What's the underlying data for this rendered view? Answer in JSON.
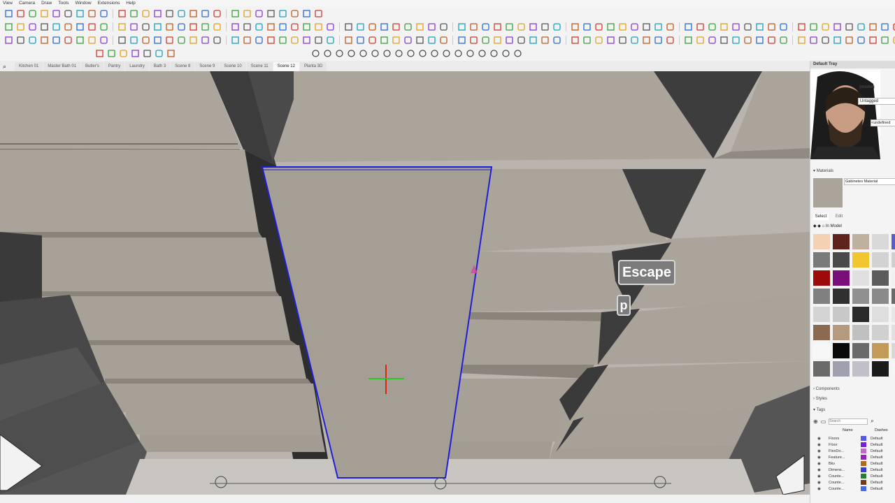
{
  "menu": [
    "View",
    "Camera",
    "Draw",
    "Tools",
    "Window",
    "Extensions",
    "Help"
  ],
  "scenes": {
    "tabs": [
      "Kitchen 01",
      "Master Bath 01",
      "Butler's",
      "Pantry",
      "Laundry",
      "Bath 3",
      "Scene 8",
      "Scene 9",
      "Scene 10",
      "Scene 11",
      "Scene 12",
      "Planta 3D"
    ],
    "active_index": 10
  },
  "tray": {
    "title": "Default Tray",
    "entity_model": "(model)",
    "tag_value": "Untagged",
    "undefined_value": "<undefined",
    "materials_header": "Materials",
    "current_material": "Gabinetes Material",
    "select_tab": "Select",
    "edit_tab": "Edit",
    "in_model": "In Model",
    "components_header": "Components",
    "styles_header": "Styles",
    "tags_header": "Tags",
    "search_placeholder": "Search",
    "col_name": "Name",
    "col_dashes": "Dashes",
    "tags": [
      {
        "name": "Floors",
        "color": "#5a5ad8",
        "dash": "Default"
      },
      {
        "name": "Floor",
        "color": "#7a1fd6",
        "dash": "Default"
      },
      {
        "name": "FlexDo...",
        "color": "#c06ac6",
        "dash": "Default"
      },
      {
        "name": "Feature...",
        "color": "#a01eb8",
        "dash": "Default"
      },
      {
        "name": "Bkv",
        "color": "#b06820",
        "dash": "Default"
      },
      {
        "name": "Dimens...",
        "color": "#3a3ad6",
        "dash": "Default"
      },
      {
        "name": "Counte...",
        "color": "#2a7a3a",
        "dash": "Default"
      },
      {
        "name": "Counte...",
        "color": "#7a3a10",
        "dash": "Default"
      },
      {
        "name": "Counte...",
        "color": "#4a6ad8",
        "dash": "Default"
      }
    ],
    "material_swatches": [
      "#f5d1b3",
      "#5e241c",
      "#bfb0a0",
      "#d9d9d9",
      "#5a5fc8",
      "#7a7a7a",
      "#4a4a4a",
      "#f2c630",
      "#d2d2d2",
      "#cfcfcf",
      "#9d0a0a",
      "#7a0f7a",
      "#e0e0e0",
      "#5c5c5c",
      "#f0f0f0",
      "#808080",
      "#303030",
      "#909090",
      "#8a8a8a",
      "#6a6a6a",
      "#d4d4d4",
      "#c8c8c8",
      "#2a2a2a",
      "#dedede",
      "#e8e8e8",
      "#8a6a50",
      "#b59a80",
      "#c0c0c0",
      "#d0d0d0",
      "#e0e0e0",
      "#f7f7f7",
      "#0a0a0a",
      "#6a6a6a",
      "#c49a5a",
      "#d8d8d8",
      "#6a6a6a",
      "#a0a0b0",
      "#c0c0c8",
      "#1a1a1a",
      "#f5f5f5"
    ]
  },
  "overlays": {
    "key1": "Escape",
    "key2": "p"
  },
  "colors": {
    "selection": "#1f1fd8",
    "wall": "#a8a096",
    "dark": "#3c3c3c"
  }
}
